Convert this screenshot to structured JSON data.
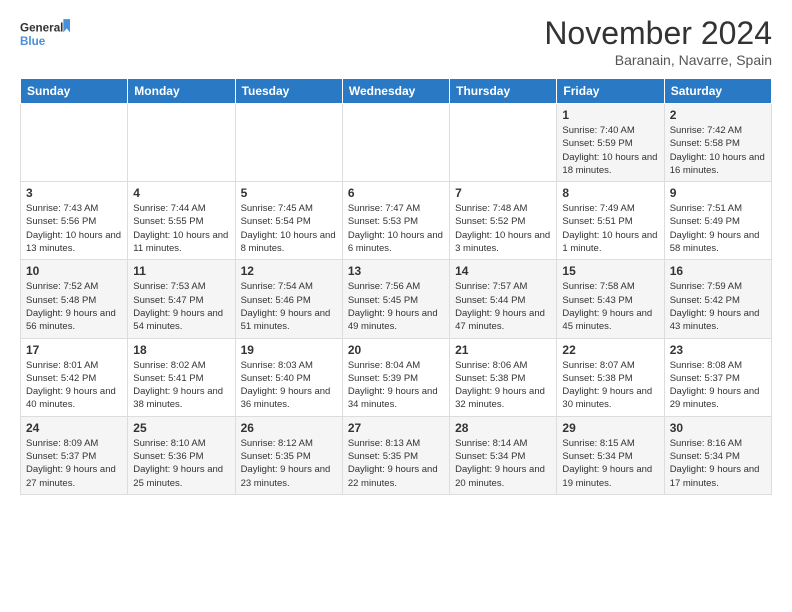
{
  "logo": {
    "line1": "General",
    "line2": "Blue"
  },
  "title": "November 2024",
  "location": "Baranain, Navarre, Spain",
  "days_of_week": [
    "Sunday",
    "Monday",
    "Tuesday",
    "Wednesday",
    "Thursday",
    "Friday",
    "Saturday"
  ],
  "weeks": [
    [
      {
        "day": "",
        "info": ""
      },
      {
        "day": "",
        "info": ""
      },
      {
        "day": "",
        "info": ""
      },
      {
        "day": "",
        "info": ""
      },
      {
        "day": "",
        "info": ""
      },
      {
        "day": "1",
        "info": "Sunrise: 7:40 AM\nSunset: 5:59 PM\nDaylight: 10 hours and 18 minutes."
      },
      {
        "day": "2",
        "info": "Sunrise: 7:42 AM\nSunset: 5:58 PM\nDaylight: 10 hours and 16 minutes."
      }
    ],
    [
      {
        "day": "3",
        "info": "Sunrise: 7:43 AM\nSunset: 5:56 PM\nDaylight: 10 hours and 13 minutes."
      },
      {
        "day": "4",
        "info": "Sunrise: 7:44 AM\nSunset: 5:55 PM\nDaylight: 10 hours and 11 minutes."
      },
      {
        "day": "5",
        "info": "Sunrise: 7:45 AM\nSunset: 5:54 PM\nDaylight: 10 hours and 8 minutes."
      },
      {
        "day": "6",
        "info": "Sunrise: 7:47 AM\nSunset: 5:53 PM\nDaylight: 10 hours and 6 minutes."
      },
      {
        "day": "7",
        "info": "Sunrise: 7:48 AM\nSunset: 5:52 PM\nDaylight: 10 hours and 3 minutes."
      },
      {
        "day": "8",
        "info": "Sunrise: 7:49 AM\nSunset: 5:51 PM\nDaylight: 10 hours and 1 minute."
      },
      {
        "day": "9",
        "info": "Sunrise: 7:51 AM\nSunset: 5:49 PM\nDaylight: 9 hours and 58 minutes."
      }
    ],
    [
      {
        "day": "10",
        "info": "Sunrise: 7:52 AM\nSunset: 5:48 PM\nDaylight: 9 hours and 56 minutes."
      },
      {
        "day": "11",
        "info": "Sunrise: 7:53 AM\nSunset: 5:47 PM\nDaylight: 9 hours and 54 minutes."
      },
      {
        "day": "12",
        "info": "Sunrise: 7:54 AM\nSunset: 5:46 PM\nDaylight: 9 hours and 51 minutes."
      },
      {
        "day": "13",
        "info": "Sunrise: 7:56 AM\nSunset: 5:45 PM\nDaylight: 9 hours and 49 minutes."
      },
      {
        "day": "14",
        "info": "Sunrise: 7:57 AM\nSunset: 5:44 PM\nDaylight: 9 hours and 47 minutes."
      },
      {
        "day": "15",
        "info": "Sunrise: 7:58 AM\nSunset: 5:43 PM\nDaylight: 9 hours and 45 minutes."
      },
      {
        "day": "16",
        "info": "Sunrise: 7:59 AM\nSunset: 5:42 PM\nDaylight: 9 hours and 43 minutes."
      }
    ],
    [
      {
        "day": "17",
        "info": "Sunrise: 8:01 AM\nSunset: 5:42 PM\nDaylight: 9 hours and 40 minutes."
      },
      {
        "day": "18",
        "info": "Sunrise: 8:02 AM\nSunset: 5:41 PM\nDaylight: 9 hours and 38 minutes."
      },
      {
        "day": "19",
        "info": "Sunrise: 8:03 AM\nSunset: 5:40 PM\nDaylight: 9 hours and 36 minutes."
      },
      {
        "day": "20",
        "info": "Sunrise: 8:04 AM\nSunset: 5:39 PM\nDaylight: 9 hours and 34 minutes."
      },
      {
        "day": "21",
        "info": "Sunrise: 8:06 AM\nSunset: 5:38 PM\nDaylight: 9 hours and 32 minutes."
      },
      {
        "day": "22",
        "info": "Sunrise: 8:07 AM\nSunset: 5:38 PM\nDaylight: 9 hours and 30 minutes."
      },
      {
        "day": "23",
        "info": "Sunrise: 8:08 AM\nSunset: 5:37 PM\nDaylight: 9 hours and 29 minutes."
      }
    ],
    [
      {
        "day": "24",
        "info": "Sunrise: 8:09 AM\nSunset: 5:37 PM\nDaylight: 9 hours and 27 minutes."
      },
      {
        "day": "25",
        "info": "Sunrise: 8:10 AM\nSunset: 5:36 PM\nDaylight: 9 hours and 25 minutes."
      },
      {
        "day": "26",
        "info": "Sunrise: 8:12 AM\nSunset: 5:35 PM\nDaylight: 9 hours and 23 minutes."
      },
      {
        "day": "27",
        "info": "Sunrise: 8:13 AM\nSunset: 5:35 PM\nDaylight: 9 hours and 22 minutes."
      },
      {
        "day": "28",
        "info": "Sunrise: 8:14 AM\nSunset: 5:34 PM\nDaylight: 9 hours and 20 minutes."
      },
      {
        "day": "29",
        "info": "Sunrise: 8:15 AM\nSunset: 5:34 PM\nDaylight: 9 hours and 19 minutes."
      },
      {
        "day": "30",
        "info": "Sunrise: 8:16 AM\nSunset: 5:34 PM\nDaylight: 9 hours and 17 minutes."
      }
    ]
  ]
}
